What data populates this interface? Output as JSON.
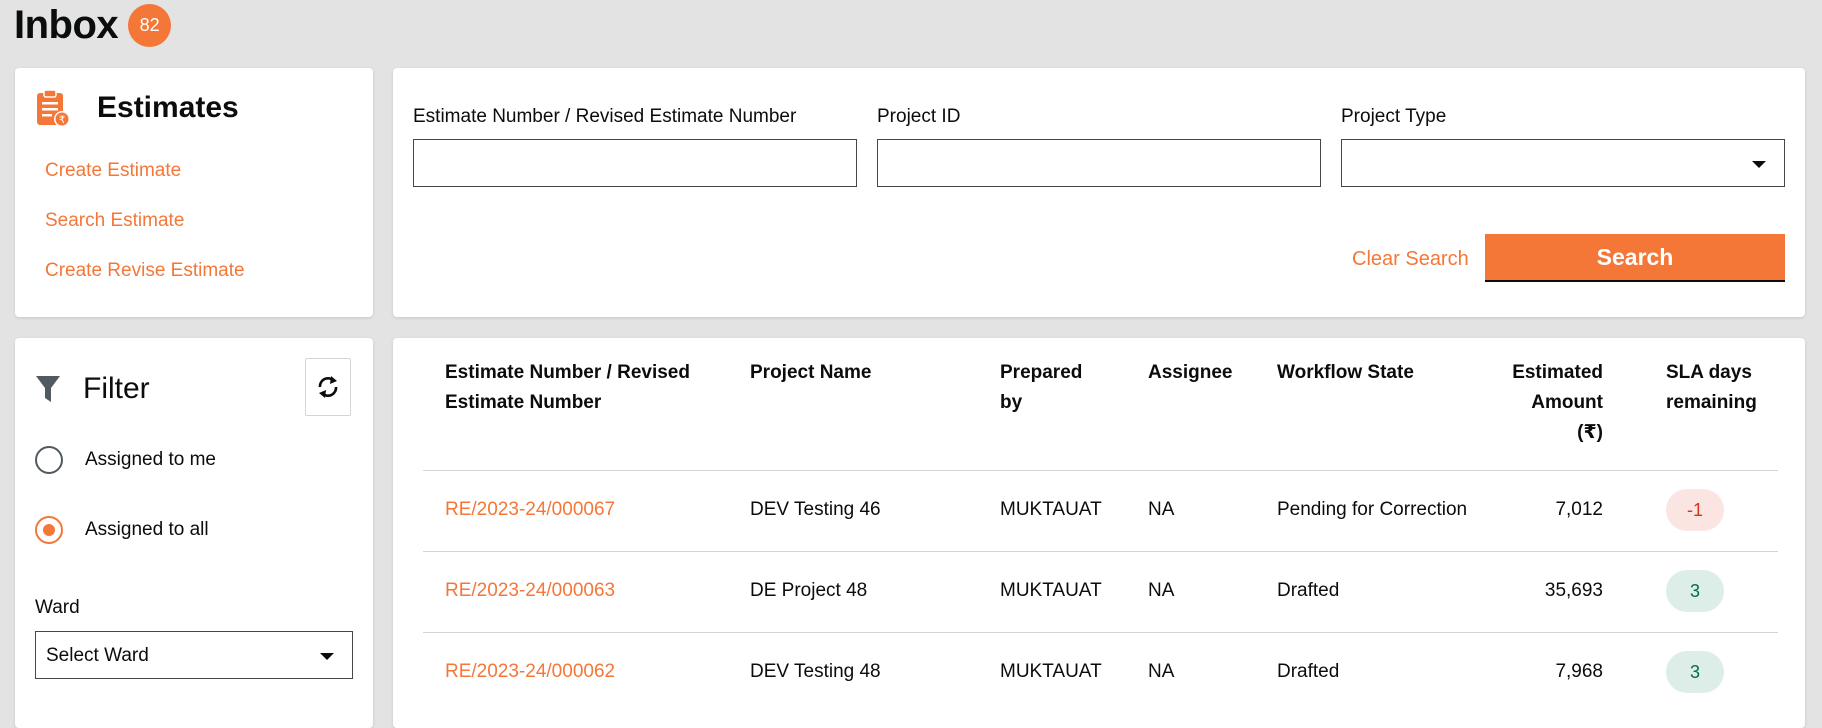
{
  "inbox": {
    "title": "Inbox",
    "count": "82"
  },
  "estimates": {
    "title": "Estimates",
    "links": [
      "Create Estimate",
      "Search Estimate",
      "Create Revise Estimate"
    ]
  },
  "search": {
    "fields": {
      "estimate_number": {
        "label": "Estimate Number / Revised Estimate Number",
        "value": ""
      },
      "project_id": {
        "label": "Project ID",
        "value": ""
      },
      "project_type": {
        "label": "Project Type",
        "value": ""
      }
    },
    "clear_label": "Clear Search",
    "search_label": "Search"
  },
  "filter": {
    "title": "Filter",
    "options": [
      {
        "label": "Assigned to me",
        "selected": false
      },
      {
        "label": "Assigned to all",
        "selected": true
      }
    ],
    "ward_label": "Ward",
    "ward_placeholder": "Select Ward"
  },
  "table": {
    "headers": {
      "estimate_number": [
        "Estimate Number / Revised",
        "Estimate Number"
      ],
      "project_name": [
        "Project Name"
      ],
      "prepared_by": [
        "Prepared",
        "by"
      ],
      "assignee": [
        "Assignee"
      ],
      "workflow_state": [
        "Workflow State"
      ],
      "estimated_amount": [
        "Estimated",
        "Amount",
        "(₹)"
      ],
      "sla": [
        "SLA days",
        "remaining"
      ]
    },
    "rows": [
      {
        "estimate_number": "RE/2023-24/000067",
        "project_name": "DEV Testing 46",
        "prepared_by": "MUKTAUAT",
        "assignee": "NA",
        "workflow_state": "Pending for Correction",
        "estimated_amount": "7,012",
        "sla": "-1"
      },
      {
        "estimate_number": "RE/2023-24/000063",
        "project_name": "DE Project 48",
        "prepared_by": "MUKTAUAT",
        "assignee": "NA",
        "workflow_state": "Drafted",
        "estimated_amount": "35,693",
        "sla": "3"
      },
      {
        "estimate_number": "RE/2023-24/000062",
        "project_name": "DEV Testing 48",
        "prepared_by": "MUKTAUAT",
        "assignee": "NA",
        "workflow_state": "Drafted",
        "estimated_amount": "7,968",
        "sla": "3"
      }
    ]
  },
  "colors": {
    "accent": "#f47738",
    "negative_badge": "#fbe5e2",
    "positive_badge": "#ddeee8"
  }
}
